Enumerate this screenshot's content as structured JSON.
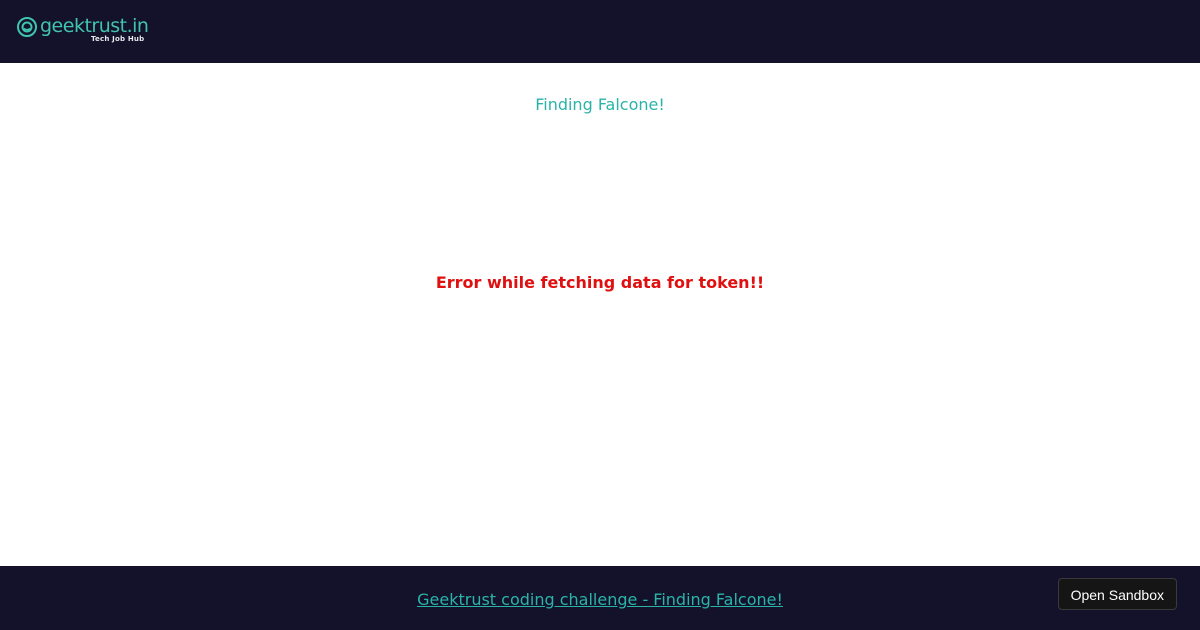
{
  "header": {
    "logo_text": "geektrust.in",
    "logo_tagline": "Tech Job Hub",
    "logo_icon": "geektrust-logo-icon",
    "background": "#13122a"
  },
  "main": {
    "title": "Finding Falcone!",
    "error_message": "Error while fetching data for token!!",
    "title_color": "#2bb3a8",
    "error_color": "#e01010"
  },
  "footer": {
    "link_text": "Geektrust coding challenge - Finding Falcone!",
    "sandbox_button_label": "Open Sandbox",
    "background": "#13122a"
  }
}
